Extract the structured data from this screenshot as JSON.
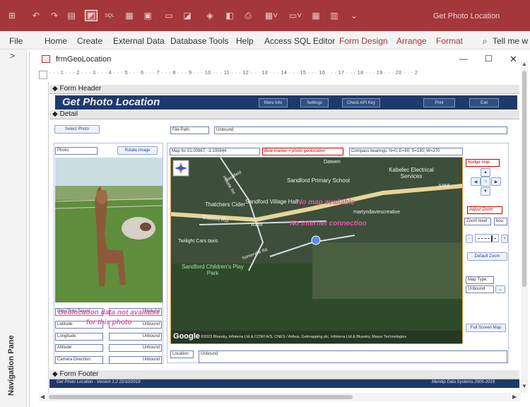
{
  "app": {
    "title": "Get Photo Location"
  },
  "ribbon": {
    "tabs": [
      "File",
      "Home",
      "Create",
      "External Data",
      "Database Tools",
      "Help",
      "Access SQL Editor",
      "Form Design",
      "Arrange",
      "Format"
    ],
    "tell_me": "Tell me w"
  },
  "nav_pane": {
    "label": "Navigation Pane",
    "toggle": ">"
  },
  "window": {
    "title": "frmGeoLocation",
    "minimize": "—",
    "maximize": "☐",
    "close": "✕"
  },
  "ruler": {
    "text": "· · · 1 · · · 2 · · · 3 · · · 4 · · · 5 · · · 6 · · · 7 · · · 8 · · · 9 · · · 10 · · · 11 · · · 12 · · · 13 · · · 14 · · · 15 · · · 16 · · · 17 · · · 18 · · · 19 · · · 20 · · · 2"
  },
  "sections": {
    "header": "Form Header",
    "detail": "Detail",
    "footer": "Form Footer"
  },
  "header": {
    "title": "Get Photo Location",
    "buttons": {
      "more_info": "More Info",
      "settings": "Settings",
      "check_api": "Check API Key",
      "print": "Print",
      "exit": "Exit"
    }
  },
  "detail": {
    "select_photo": "Select Photo",
    "file_path_label": "File Path:",
    "file_path_value": "Unbound",
    "photo_label": "Photo:",
    "rotate_image": "Rotate Image",
    "map_for": "Map for 51.00967, -3.100844",
    "blue_marker": "Blue marker = photo geolocation",
    "compass": "Compass bearings: N=0; E=90; S=180; W=270",
    "nudge_map": "Nudge map",
    "adjust_zoom": "Adjust Zoom",
    "zoom_level_label": "Zoom level",
    "zoom_level_value": "bou",
    "default_zoom": "Default Zoom",
    "map_type_label": "Map Type:",
    "map_type_value": "Unbound",
    "full_screen_map": "Full Screen Map",
    "no_map": "No map available",
    "no_internet": "No internet connection",
    "geo_not_available_1": "Geolocation data not available",
    "geo_not_available_2": "for this photo",
    "fields": [
      {
        "label": "Date/Time Taken:",
        "value": "Unbound"
      },
      {
        "label": "Latitude:",
        "value": "Unbound"
      },
      {
        "label": "Longitude:",
        "value": "Unbound"
      },
      {
        "label": "Altitude:",
        "value": "Unbound"
      },
      {
        "label": "Camera Direction:",
        "value": "Unbound"
      }
    ],
    "location_label": "Location:",
    "location_value": "Unbound"
  },
  "map_labels": {
    "school": "Sandford Primary School",
    "kabelec": "Kabelec Electrical Services",
    "thatchers": "Thatchers Cider",
    "sandford_village": "Sandford Village Hall",
    "creative": "martyndaviescreative",
    "station": "Station Rd",
    "a368a": "A368",
    "a368b": "A368",
    "twilight": "Twilight Cars taxis",
    "somerville": "Somerville Rd",
    "playpark": "Sandford Children's Play Park",
    "google": "Google",
    "copyright": "©2023 Bluesky, Infoterra Ltd & COWI A/S, CNES / Airbus, Getmapping plc, Infoterra Ltd & Bluesky, Maxar Technologies",
    "datwen": "Datwen",
    "sandfield": "Sandfield",
    "hillside": "Hillside Rd"
  },
  "footer": {
    "left": "Get Photo Location - Version 1.2  22/10/2019",
    "right": "Mendip Data Systems 2005-2019"
  },
  "colors": {
    "titlebar": "#a4373a",
    "header_band": "#1e3a6a",
    "accent_pink": "#e05aa8",
    "map_border": "#e39a3a"
  }
}
